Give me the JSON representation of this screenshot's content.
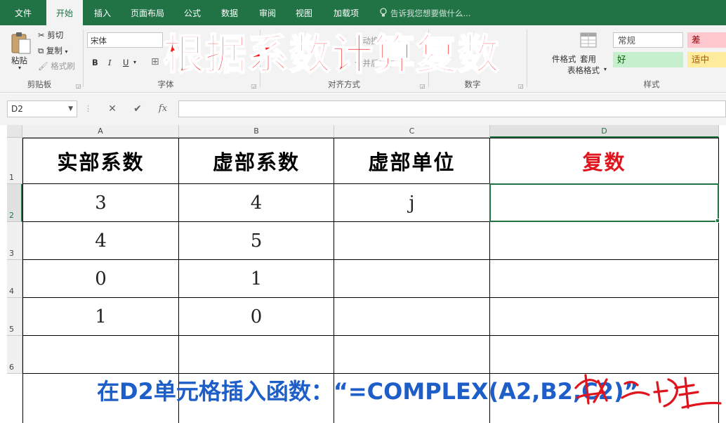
{
  "tabs": [
    "文件",
    "开始",
    "插入",
    "页面布局",
    "公式",
    "数据",
    "审阅",
    "视图",
    "加载项"
  ],
  "tell_me": "告诉我您想要做什么...",
  "ribbon": {
    "clipboard": {
      "paste": "粘贴",
      "cut": "剪切",
      "copy": "复制",
      "format_painter": "格式刷",
      "label": "剪贴板"
    },
    "font": {
      "name": "宋体",
      "bold": "B",
      "italic": "I",
      "underline": "U",
      "label": "字体"
    },
    "alignment": {
      "wrap": "自动换行",
      "merge": "合并后居中",
      "label": "对齐方式"
    },
    "number": {
      "label": "数字"
    },
    "styles": {
      "conditional": "件格式",
      "table_format_1": "套用",
      "table_format_2": "表格格式",
      "normal": "常规",
      "bad": "差",
      "good": "好",
      "neutral": "适中",
      "label": "样式"
    }
  },
  "overlay_title": "根据系数计算复数",
  "formula_bar": {
    "name_box": "D2",
    "cancel": "✕",
    "enter": "✔",
    "fx": "fx",
    "value": ""
  },
  "columns": [
    "A",
    "B",
    "C",
    "D"
  ],
  "rows": [
    "1",
    "2",
    "3",
    "4",
    "5",
    "6"
  ],
  "table": {
    "headers": [
      "实部系数",
      "虚部系数",
      "虚部单位",
      "复数"
    ],
    "body": [
      [
        "3",
        "4",
        "j",
        ""
      ],
      [
        "4",
        "5",
        "",
        ""
      ],
      [
        "0",
        "1",
        "",
        ""
      ],
      [
        "1",
        "0",
        "",
        ""
      ],
      [
        "",
        "",
        "",
        ""
      ]
    ]
  },
  "selected_cell": "D2",
  "instruction": "在D2单元格插入函数：“=COMPLEX(A2,B2,C2)”",
  "colors": {
    "excel_green": "#217346",
    "title_red": "#ff1a1a",
    "header_red": "#e0141c",
    "instruction_blue": "#1d5ec9"
  }
}
